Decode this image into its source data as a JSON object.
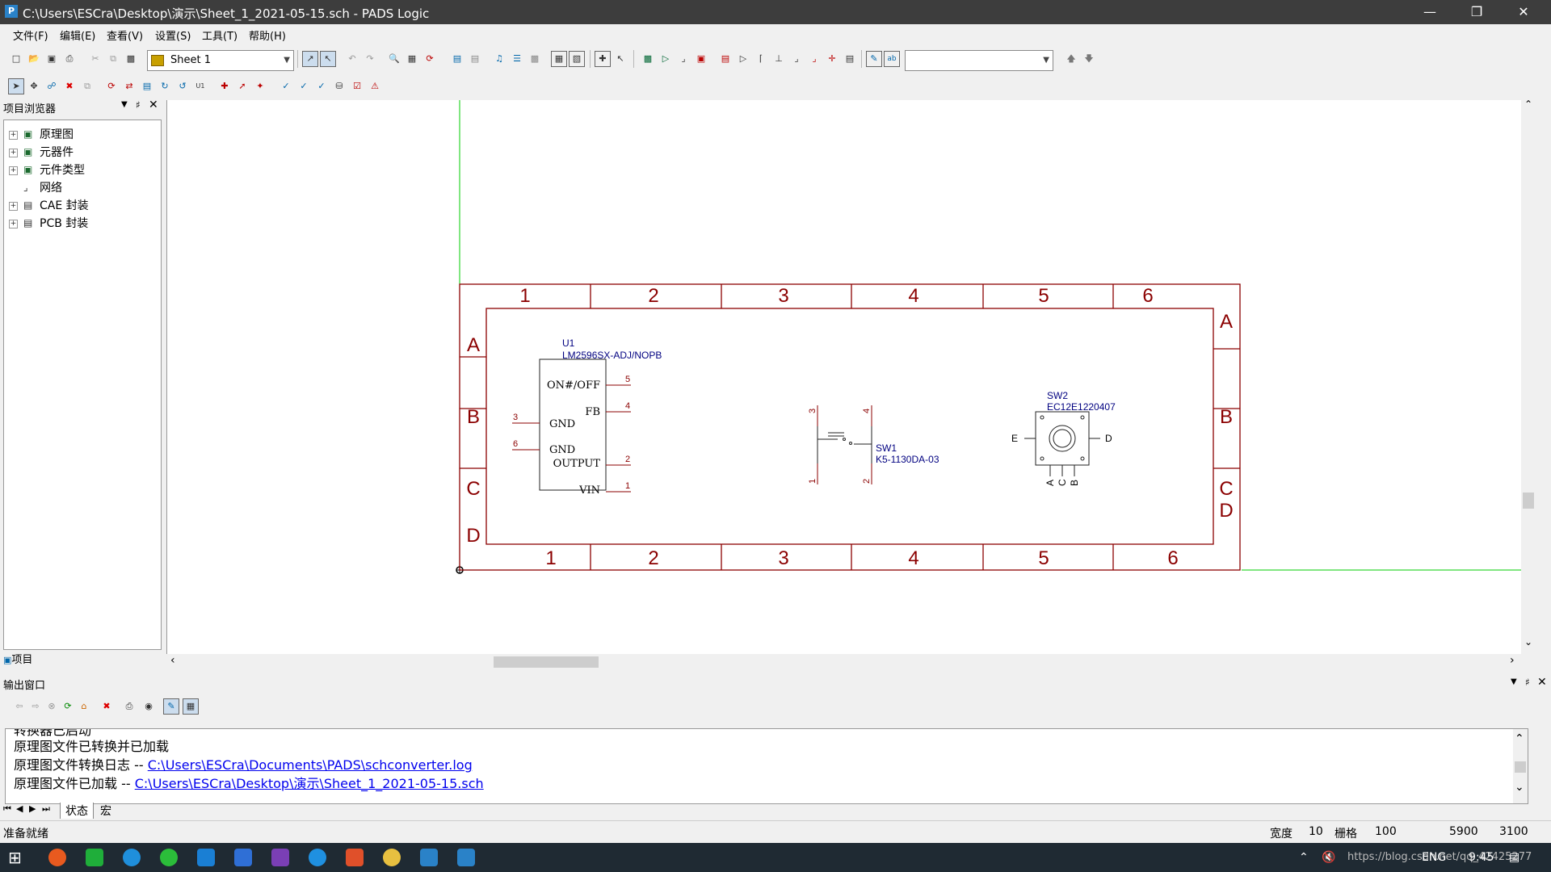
{
  "window": {
    "title": "C:\\Users\\ESCra\\Desktop\\演示\\Sheet_1_2021-05-15.sch - PADS Logic",
    "app_icon": "pads-logic-icon",
    "controls": [
      "minimize-icon",
      "restore-icon",
      "close-icon"
    ]
  },
  "menu": [
    "文件(F)",
    "编辑(E)",
    "查看(V)",
    "设置(S)",
    "工具(T)",
    "帮助(H)"
  ],
  "toolbar": {
    "sheet_combo": "Sheet 1",
    "search_combo": ""
  },
  "browser": {
    "title": "项目浏览器",
    "items": [
      {
        "label": "原理图",
        "expandable": true
      },
      {
        "label": "元器件",
        "expandable": true
      },
      {
        "label": "元件类型",
        "expandable": true
      },
      {
        "label": "网络",
        "expandable": false
      },
      {
        "label": "CAE 封装",
        "expandable": true
      },
      {
        "label": "PCB 封装",
        "expandable": true
      }
    ],
    "tab": "项目"
  },
  "schematic": {
    "border_color": "#8b0000",
    "columns": [
      "1",
      "2",
      "3",
      "4",
      "5",
      "6"
    ],
    "rows_left": [
      "A",
      "B",
      "C",
      "D"
    ],
    "rows_right": [
      "A",
      "B",
      "C",
      "D"
    ],
    "u1": {
      "ref": "U1",
      "part": "LM2596SX-ADJ/NOPB",
      "pins_left": [
        {
          "num": "3",
          "name": "GND"
        },
        {
          "num": "6",
          "name": "GND"
        }
      ],
      "pins_right": [
        {
          "num": "5",
          "name": "ON#/OFF"
        },
        {
          "num": "4",
          "name": "FB"
        },
        {
          "num": "2",
          "name": "OUTPUT"
        },
        {
          "num": "1",
          "name": "VIN"
        }
      ]
    },
    "sw1": {
      "ref": "SW1",
      "part": "K5-1130DA-03",
      "pins": [
        "3",
        "4",
        "1",
        "2"
      ]
    },
    "sw2": {
      "ref": "SW2",
      "part": "EC12E1220407",
      "pins": [
        "E",
        "D",
        "A",
        "C",
        "B"
      ]
    }
  },
  "output": {
    "title": "输出窗口",
    "lines": [
      {
        "text": "转换器已启动",
        "link": ""
      },
      {
        "text": "原理图文件已转换并已加载",
        "link": ""
      },
      {
        "text": "原理图文件转换日志 -- ",
        "link": "C:\\Users\\ESCra\\Documents\\PADS\\schconverter.log"
      },
      {
        "text": "原理图文件已加载 -- ",
        "link": "C:\\Users\\ESCra\\Desktop\\演示\\Sheet_1_2021-05-15.sch"
      }
    ],
    "tabs": [
      "状态",
      "宏"
    ]
  },
  "status": {
    "message": "准备就绪",
    "width_label": "宽度",
    "width_value": "10",
    "grid_label": "栅格",
    "grid_value": "100",
    "x": "5900",
    "y": "3100"
  },
  "taskbar": {
    "tray_lang": "ENG",
    "time": "9:45",
    "watermark": "https://blog.csdn.net/qq_42425277"
  }
}
